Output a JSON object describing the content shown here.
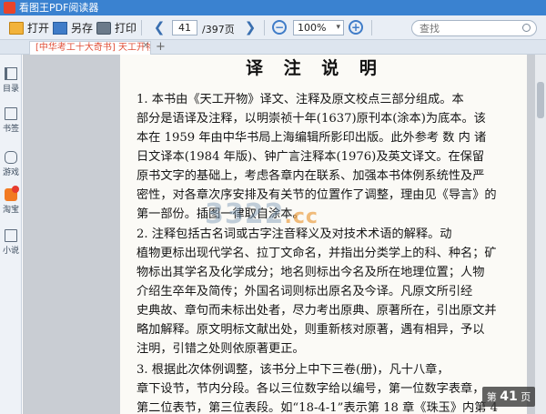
{
  "window": {
    "title": "看图王PDF阅读器"
  },
  "toolbar": {
    "open_label": "打开",
    "save_as_label": "另存",
    "print_label": "打印",
    "page_current": "41",
    "page_total": "/397页",
    "zoom_value": "100%",
    "zoom_out": "−",
    "zoom_in": "+",
    "search_placeholder": "查找"
  },
  "tabs": [
    {
      "label": "[中华考工十大奇书] 天工开物"
    }
  ],
  "sidebar": {
    "items": [
      {
        "label": "目录",
        "icon": "toc-icon"
      },
      {
        "label": "书签",
        "icon": "bookmark-icon"
      },
      {
        "label": "游戏",
        "icon": "gamepad-icon"
      },
      {
        "label": "淘宝",
        "icon": "taobao-icon"
      },
      {
        "label": "小说",
        "icon": "novel-icon"
      }
    ]
  },
  "document": {
    "heading": "译 注 说 明",
    "lines": [
      "1. 本书由《天工开物》译文、注释及原文校点三部分组成。本",
      "部分是语译及注释，以明崇祯十年(1637)原刊本(涂本)为底本。该",
      "本在 1959 年由中华书局上海编辑所影印出版。此外参考 数 内 诸",
      "日文译本(1984 年版)、钟广言注释本(1976)及英文译文。在保留",
      "原书文字的基础上，考虑各章内在联系、加强本书体例系统性及严",
      "密性，对各章次序安排及有关节的位置作了调整，理由见《导言》的",
      "第一部份。插图一律取自涂本。",
      "2. 注释包括古名词或古字注音释义及对技术术语的解释。动",
      "植物更标出现代学名、拉丁文命名，并指出分类学上的科、种名；矿",
      "物标出其学名及化学成分；地名则标出今名及所在地理位置；人物",
      "介绍生卒年及简传；外国名词则标出原名及今译。凡原文所引经",
      "史典故、章句而未标出处者，尽力考出原典、原著所在，引出原文并",
      "略加解释。原文明标文献出处，则重新核对原著，遇有相异，予以",
      "注明，引错之处则依原著更正。",
      "3. 根据此次体例调整，该书分上中下三卷(册)，凡十八章，",
      "章下设节，节内分段。各以三位数字给以编号，第一位数字表章，",
      "第二位表节，第三位表段。如“18-4-1”表示第 18 章《珠玉》内第 4"
    ]
  },
  "watermark": {
    "main": "3322",
    "suffix": ".cc"
  },
  "page_indicator": {
    "prefix": "第",
    "number": "41",
    "suffix": "页"
  }
}
